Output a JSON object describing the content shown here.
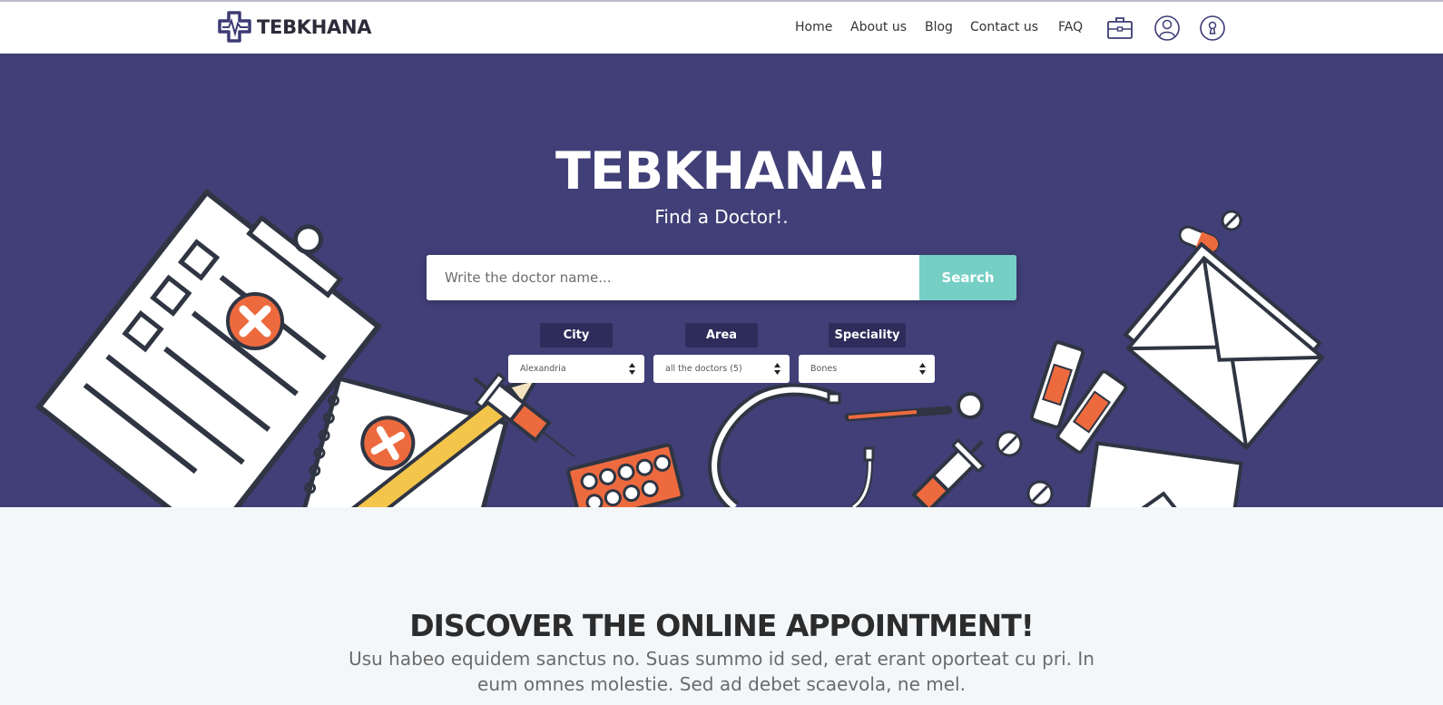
{
  "header": {
    "logo_text": "TEBKHANA",
    "nav": [
      {
        "label": "Home"
      },
      {
        "label": "About us"
      },
      {
        "label": "Blog"
      },
      {
        "label": "Contact us"
      },
      {
        "label": "FAQ"
      }
    ],
    "icons": [
      "briefcase-icon",
      "user-icon",
      "keyhole-icon"
    ]
  },
  "hero": {
    "title": "TEBKHANA!",
    "subtitle": "Find a Doctor!.",
    "search_placeholder": "Write the doctor name...",
    "search_button": "Search",
    "filters": [
      {
        "label": "City",
        "value": "Alexandria"
      },
      {
        "label": "Area",
        "value": "all the doctors (5)"
      },
      {
        "label": "Speciality",
        "value": "Bones"
      }
    ]
  },
  "section": {
    "title_prefix": "DISCOVER THE ",
    "title_bold": "ONLINE",
    "title_suffix": " APPOINTMENT!",
    "text": "Usu habeo equidem sanctus no. Suas summo id sed, erat erant oporteat cu pri. In eum omnes molestie. Sed ad debet scaevola, ne mel."
  },
  "colors": {
    "hero_bg": "#413f77",
    "accent": "#76cfc5",
    "orange": "#ed6a3f",
    "label_bg": "#2e2c5a"
  }
}
